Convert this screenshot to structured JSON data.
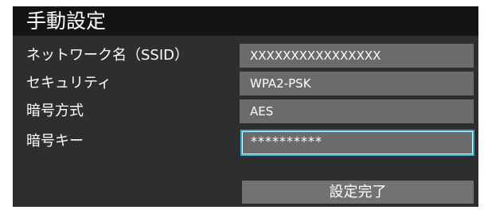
{
  "title": "手動設定",
  "rows": [
    {
      "label": "ネットワーク名（SSID）",
      "value": "XXXXXXXXXXXXXXXX"
    },
    {
      "label": "セキュリティ",
      "value": "WPA2-PSK"
    },
    {
      "label": "暗号方式",
      "value": "AES"
    },
    {
      "label": "暗号キー",
      "value": "**********"
    }
  ],
  "done_button": "設定完了",
  "colors": {
    "panel": "#2e2e2e",
    "title_bar": "#141414",
    "field": "#6b6b6b",
    "focus_border": "#2fb0d8"
  }
}
